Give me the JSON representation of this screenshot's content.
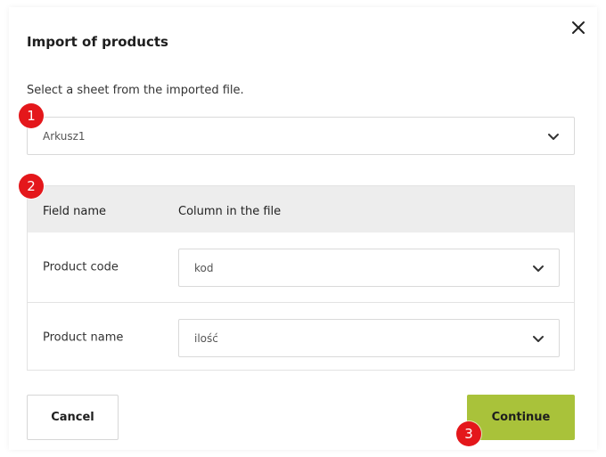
{
  "dialog": {
    "title": "Import of products",
    "instruction": "Select a sheet from the imported file."
  },
  "sheet_select": {
    "value": "Arkusz1"
  },
  "table": {
    "headers": [
      "Field name",
      "Column in the file"
    ],
    "rows": [
      {
        "field": "Product code",
        "column": "kod"
      },
      {
        "field": "Product name",
        "column": "ilość"
      }
    ]
  },
  "buttons": {
    "cancel": "Cancel",
    "continue": "Continue"
  },
  "badges": [
    "1",
    "2",
    "3"
  ],
  "colors": {
    "accent": "#a9c23a",
    "badge": "#e4171b",
    "table_header_bg": "#ededed"
  },
  "icons": {
    "close": "close-icon",
    "dropdown": "chevron-down-icon"
  }
}
